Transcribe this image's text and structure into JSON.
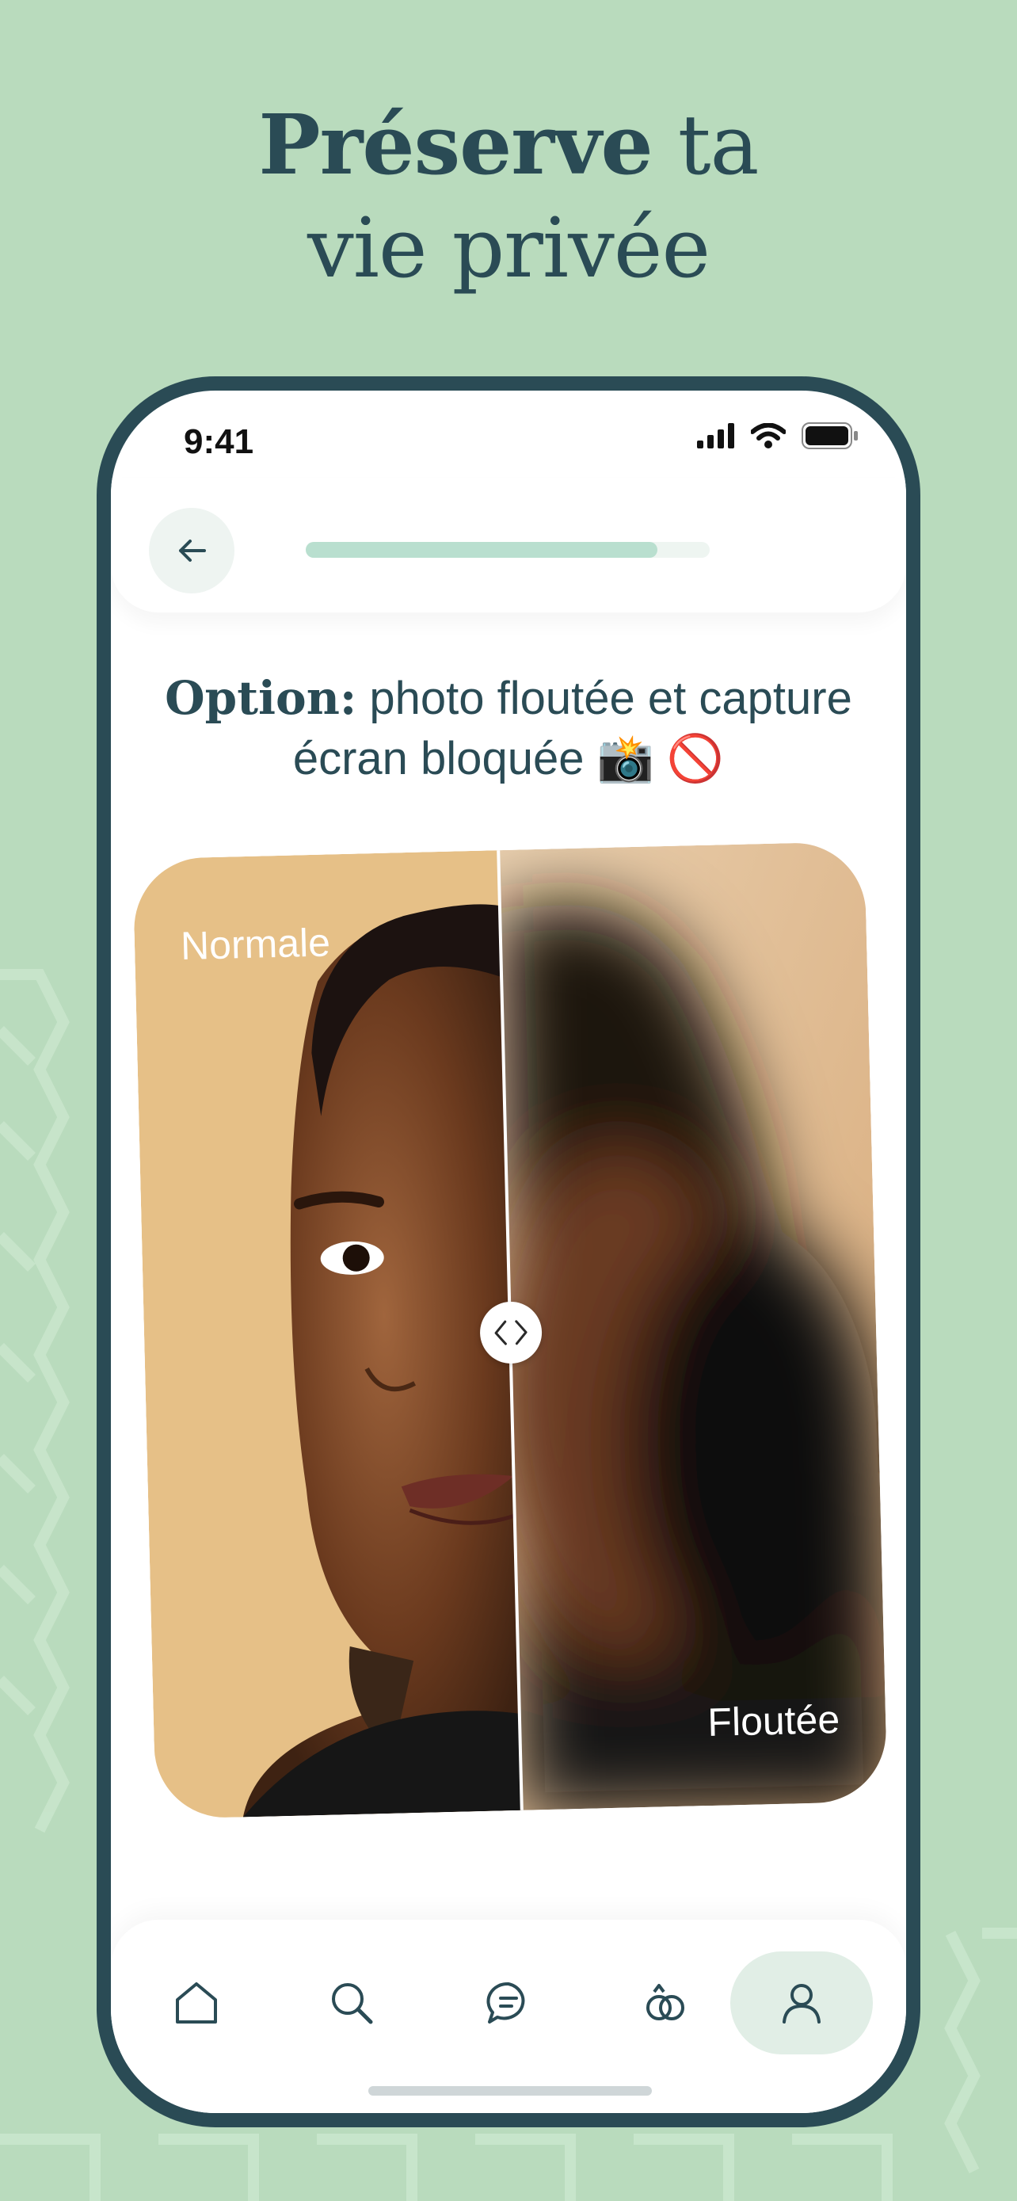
{
  "headline": {
    "bold": "Préserve",
    "line1_rest": " ta",
    "line2": "vie privée"
  },
  "status": {
    "time": "9:41"
  },
  "nav": {
    "back_icon": "arrow-left-icon",
    "progress": 0.87
  },
  "option": {
    "lead": "Option:",
    "text": " photo floutée et capture écran bloquée 📸 🚫"
  },
  "compare": {
    "left_label": "Normale",
    "right_label": "Floutée",
    "handle_icon": "chevron-left-right-icon"
  },
  "tabs": [
    {
      "icon": "home-icon",
      "active": false
    },
    {
      "icon": "search-icon",
      "active": false
    },
    {
      "icon": "chat-icon",
      "active": false
    },
    {
      "icon": "rings-icon",
      "active": false
    },
    {
      "icon": "profile-icon",
      "active": true
    }
  ],
  "colors": {
    "background": "#b9dbbd",
    "frame": "#2a4b55",
    "accent": "#b9dfcf",
    "active_tab": "#e1eee6"
  }
}
